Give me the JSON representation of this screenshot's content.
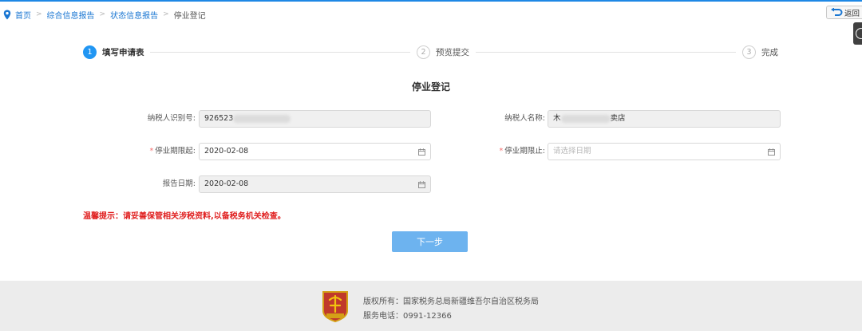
{
  "breadcrumb": {
    "items": [
      "首页",
      "综合信息报告",
      "状态信息报告"
    ],
    "current": "停业登记",
    "separator": ">"
  },
  "back_button": {
    "label": "返回"
  },
  "steps": [
    {
      "number": "1",
      "label": "填写申请表",
      "state": "active"
    },
    {
      "number": "2",
      "label": "预览提交",
      "state": "todo"
    },
    {
      "number": "3",
      "label": "完成",
      "state": "todo"
    }
  ],
  "form": {
    "title": "停业登记",
    "taxpayer_id": {
      "label": "纳税人识别号:",
      "value_visible": "926523"
    },
    "taxpayer_name": {
      "label": "纳税人名称:",
      "value_prefix": "木",
      "value_suffix": "卖店"
    },
    "suspension_start": {
      "label": "停业期限起:",
      "required": "*",
      "value": "2020-02-08"
    },
    "suspension_end": {
      "label": "停业期限止:",
      "required": "*",
      "placeholder": "请选择日期"
    },
    "report_date": {
      "label": "报告日期:",
      "value": "2020-02-08"
    }
  },
  "warning": "温馨提示：请妥善保管相关涉税资料,以备税务机关检查。",
  "next_button": {
    "label": "下一步"
  },
  "footer": {
    "copyright": "版权所有：国家税务总局新疆维吾尔自治区税务局",
    "phone": "服务电话：0991-12366",
    "logo_text": "中国税务"
  },
  "colors": {
    "accent": "#2196f3",
    "link": "#1976d2",
    "warning": "#e02020",
    "button": "#6db3ef",
    "footer_bg": "#ececec"
  },
  "icons": [
    "location-pin-icon",
    "back-arrow-icon",
    "help-icon",
    "calendar-icon",
    "tax-emblem-icon"
  ]
}
